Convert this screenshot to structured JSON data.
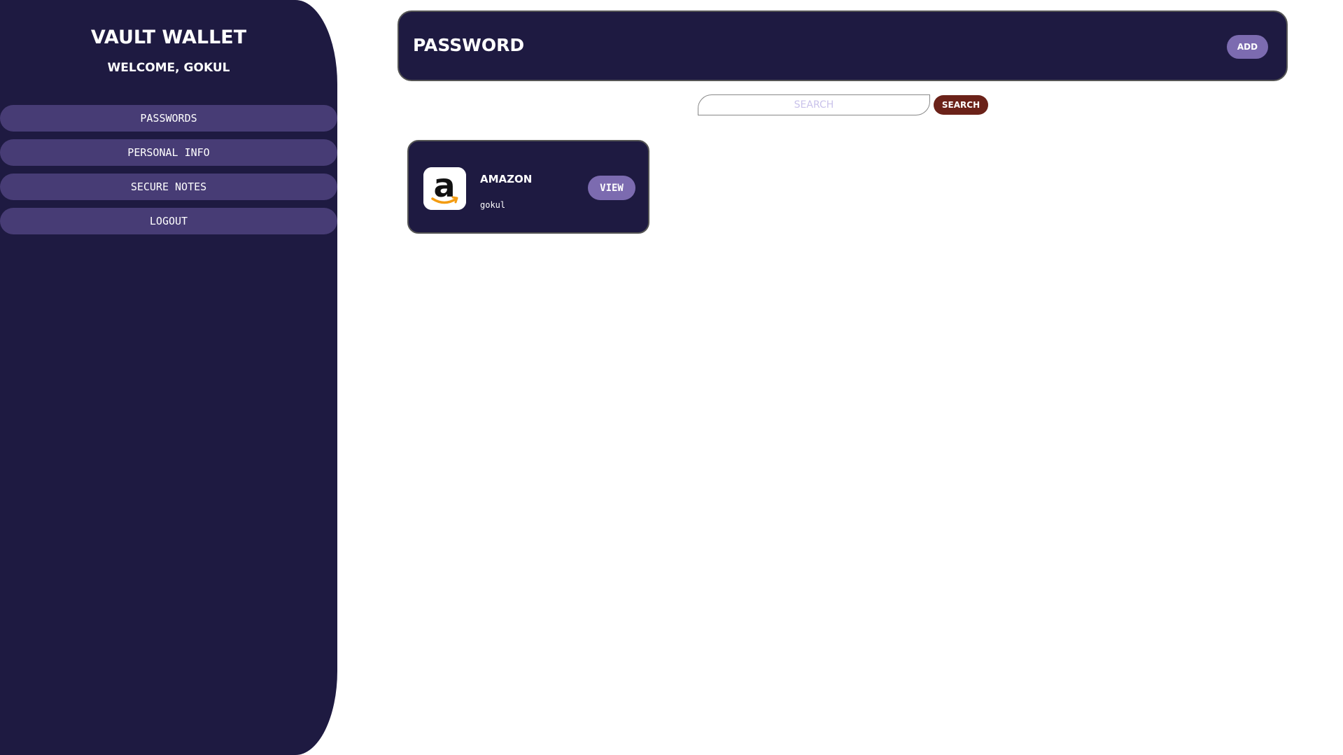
{
  "sidebar": {
    "brand": "VAULT WALLET",
    "welcome": "WELCOME, GOKUL",
    "items": [
      {
        "label": "PASSWORDS"
      },
      {
        "label": "PERSONAL INFO"
      },
      {
        "label": "SECURE NOTES"
      },
      {
        "label": "LOGOUT"
      }
    ]
  },
  "header": {
    "title": "PASSWORD",
    "add_label": "ADD"
  },
  "search": {
    "placeholder": "SEARCH",
    "value": "",
    "button_label": "SEARCH"
  },
  "entries": [
    {
      "name": "AMAZON",
      "username": "gokul",
      "icon": "amazon-logo-icon",
      "view_label": "VIEW"
    }
  ],
  "colors": {
    "sidebar_bg": "#1e1a41",
    "nav_item_bg": "#473c75",
    "accent_button": "#7c6bb0",
    "search_button": "#6b2219",
    "page_bg": "#ffffff"
  }
}
